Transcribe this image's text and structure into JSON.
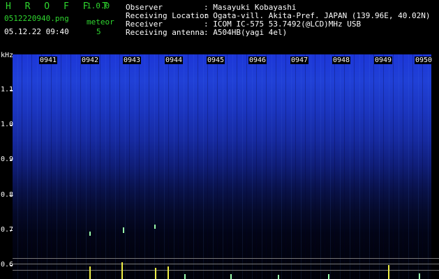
{
  "header": {
    "app_name": "H R O F F T",
    "version": "1.0.0",
    "filename": "0512220940.png",
    "meteor_label": "meteor",
    "meteor_count": "5",
    "timestamp": "05.12.22 09:40",
    "rows": [
      {
        "key": "Observer",
        "value": ": Masayuki Kobayashi"
      },
      {
        "key": "Receiving Location",
        "value": ": Ogata-vill. Akita-Pref. JAPAN (139.96E, 40.02N)"
      },
      {
        "key": "Receiver",
        "value": ": ICOM IC-575 53.7492(@LCD)MHz USB"
      },
      {
        "key": "Receiving antenna",
        "value": ": A504HB(yagi 4el)"
      }
    ]
  },
  "spectrogram": {
    "y_unit": "kHz",
    "y_ticks": [
      "1.1",
      "1.0",
      "0.9",
      "0.8",
      "0.7",
      "0.6"
    ],
    "time_labels": [
      "0941",
      "0942",
      "0943",
      "0944",
      "0945",
      "0946",
      "0947",
      "0948",
      "0949",
      "0950"
    ],
    "colors": {
      "signal": "#2040d6",
      "background": "#000000"
    }
  }
}
